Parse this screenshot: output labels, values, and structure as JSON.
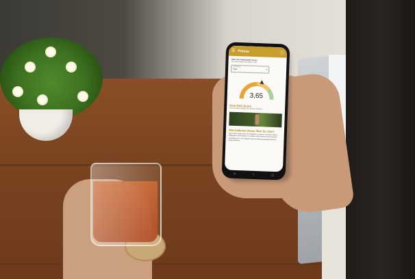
{
  "app": {
    "title": "Presse",
    "intro": "Über die Dashboard-Score",
    "sub": "So interpretierst du diese Zahl",
    "dropdown": {
      "label": "Zielgruppe",
      "value": "Frau"
    },
    "score": "3,65",
    "section1": "Dein EAS-Score",
    "section1_caption": "Score-Interpretation für diesen Bereich",
    "section2": "Was bedeutet dieser Wert für dich?",
    "paragraph": "Dieser Wert zeigt, wie du im Vergleich zu anderen Personen deiner Zielgruppe abschneidest. Ein höherer Wert deutet auf eine bessere Ausprägung hin, ein niedriger Wert auf Verbesserungspotenzial in diesem Bereich.",
    "colors": {
      "accent": "#c79d2e",
      "gauge_low": "#e8a33b",
      "gauge_high": "#a9d1a0"
    },
    "icons": {
      "menu": "menu-icon",
      "help": "help-icon",
      "dropdown": "chevron-down-icon"
    },
    "nav": [
      "back",
      "home",
      "recents"
    ]
  }
}
